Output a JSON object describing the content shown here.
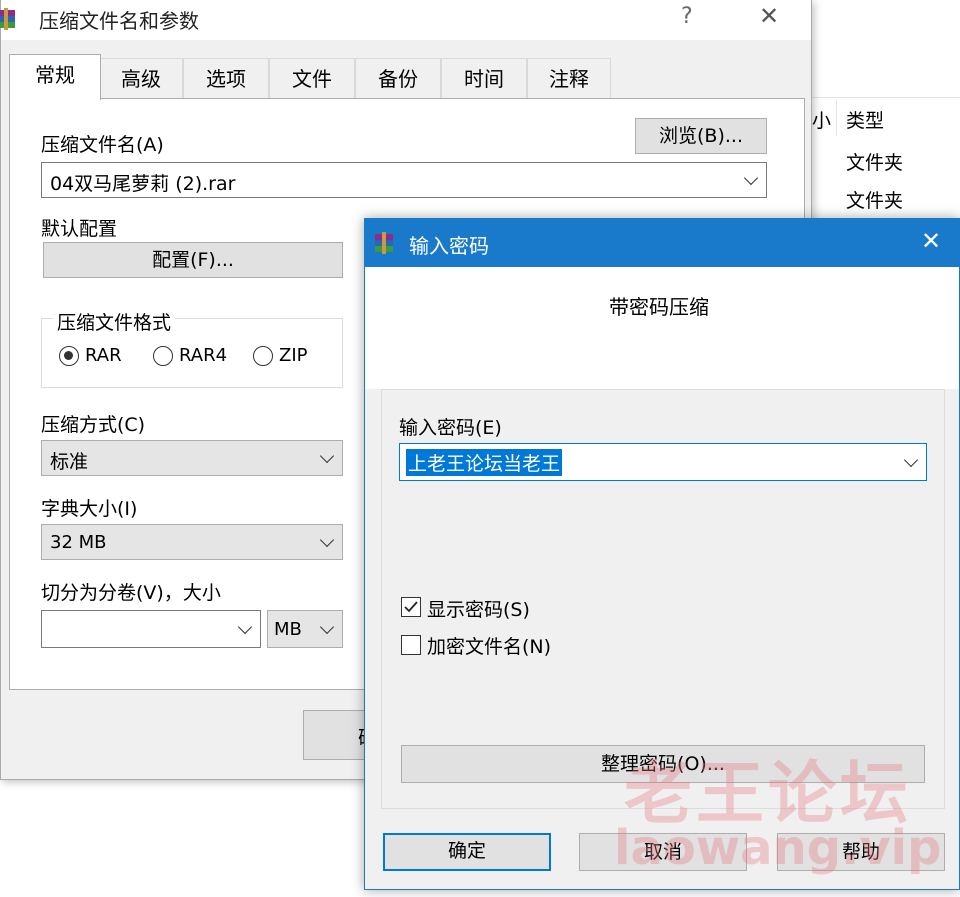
{
  "background_list": {
    "size_col_partial": "小",
    "type_header": "类型",
    "rows": [
      "文件夹",
      "文件夹"
    ]
  },
  "main_dialog": {
    "title": "压缩文件名和参数",
    "help_glyph": "?",
    "close_glyph": "✕",
    "tabs": [
      "常规",
      "高级",
      "选项",
      "文件",
      "备份",
      "时间",
      "注释"
    ],
    "archive_name_label": "压缩文件名(A)",
    "browse_button": "浏览(B)...",
    "archive_name_value": "04双马尾萝莉 (2).rar",
    "default_profile_label": "默认配置",
    "profile_button": "配置(F)...",
    "format_group_label": "压缩文件格式",
    "formats": [
      {
        "label": "RAR",
        "selected": true
      },
      {
        "label": "RAR4",
        "selected": false
      },
      {
        "label": "ZIP",
        "selected": false
      }
    ],
    "method_label": "压缩方式(C)",
    "method_value": "标准",
    "dict_label": "字典大小(I)",
    "dict_value": "32 MB",
    "split_label": "切分为分卷(V)，大小",
    "split_value": "",
    "split_unit": "MB",
    "ok_partial": "确"
  },
  "password_dialog": {
    "title": "输入密码",
    "close_glyph": "✕",
    "heading": "带密码压缩",
    "enter_label": "输入密码(E)",
    "password_value": "上老王论坛当老王",
    "show_password": {
      "label": "显示密码(S)",
      "checked": true
    },
    "encrypt_names": {
      "label": "加密文件名(N)",
      "checked": false
    },
    "organize_button": "整理密码(O)...",
    "ok_button": "确定",
    "cancel_button": "取消",
    "help_button": "帮助"
  },
  "watermark": {
    "cn": "老王论坛",
    "en": "laowang.vip"
  }
}
